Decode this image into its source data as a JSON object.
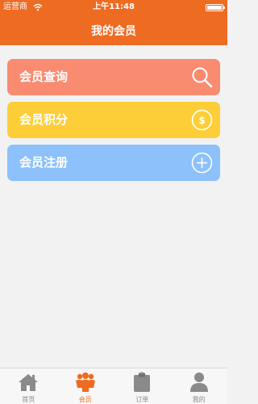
{
  "status_bar": {
    "carrier": "运营商",
    "time": "上午11:48"
  },
  "header": {
    "title": "我的会员"
  },
  "menu": [
    {
      "label": "会员查询",
      "icon": "search-icon",
      "color": "#f98b70"
    },
    {
      "label": "会员积分",
      "icon": "coin-icon",
      "color": "#fdce37"
    },
    {
      "label": "会员注册",
      "icon": "plus-icon",
      "color": "#8cc1fb"
    }
  ],
  "tabs": [
    {
      "label": "首页",
      "icon": "home-icon",
      "active": false
    },
    {
      "label": "会员",
      "icon": "members-icon",
      "active": true
    },
    {
      "label": "订单",
      "icon": "clipboard-icon",
      "active": false
    },
    {
      "label": "我的",
      "icon": "person-icon",
      "active": false
    }
  ],
  "colors": {
    "accent": "#ee6b22",
    "background": "#f2f2f2",
    "tab_inactive": "#888888"
  }
}
